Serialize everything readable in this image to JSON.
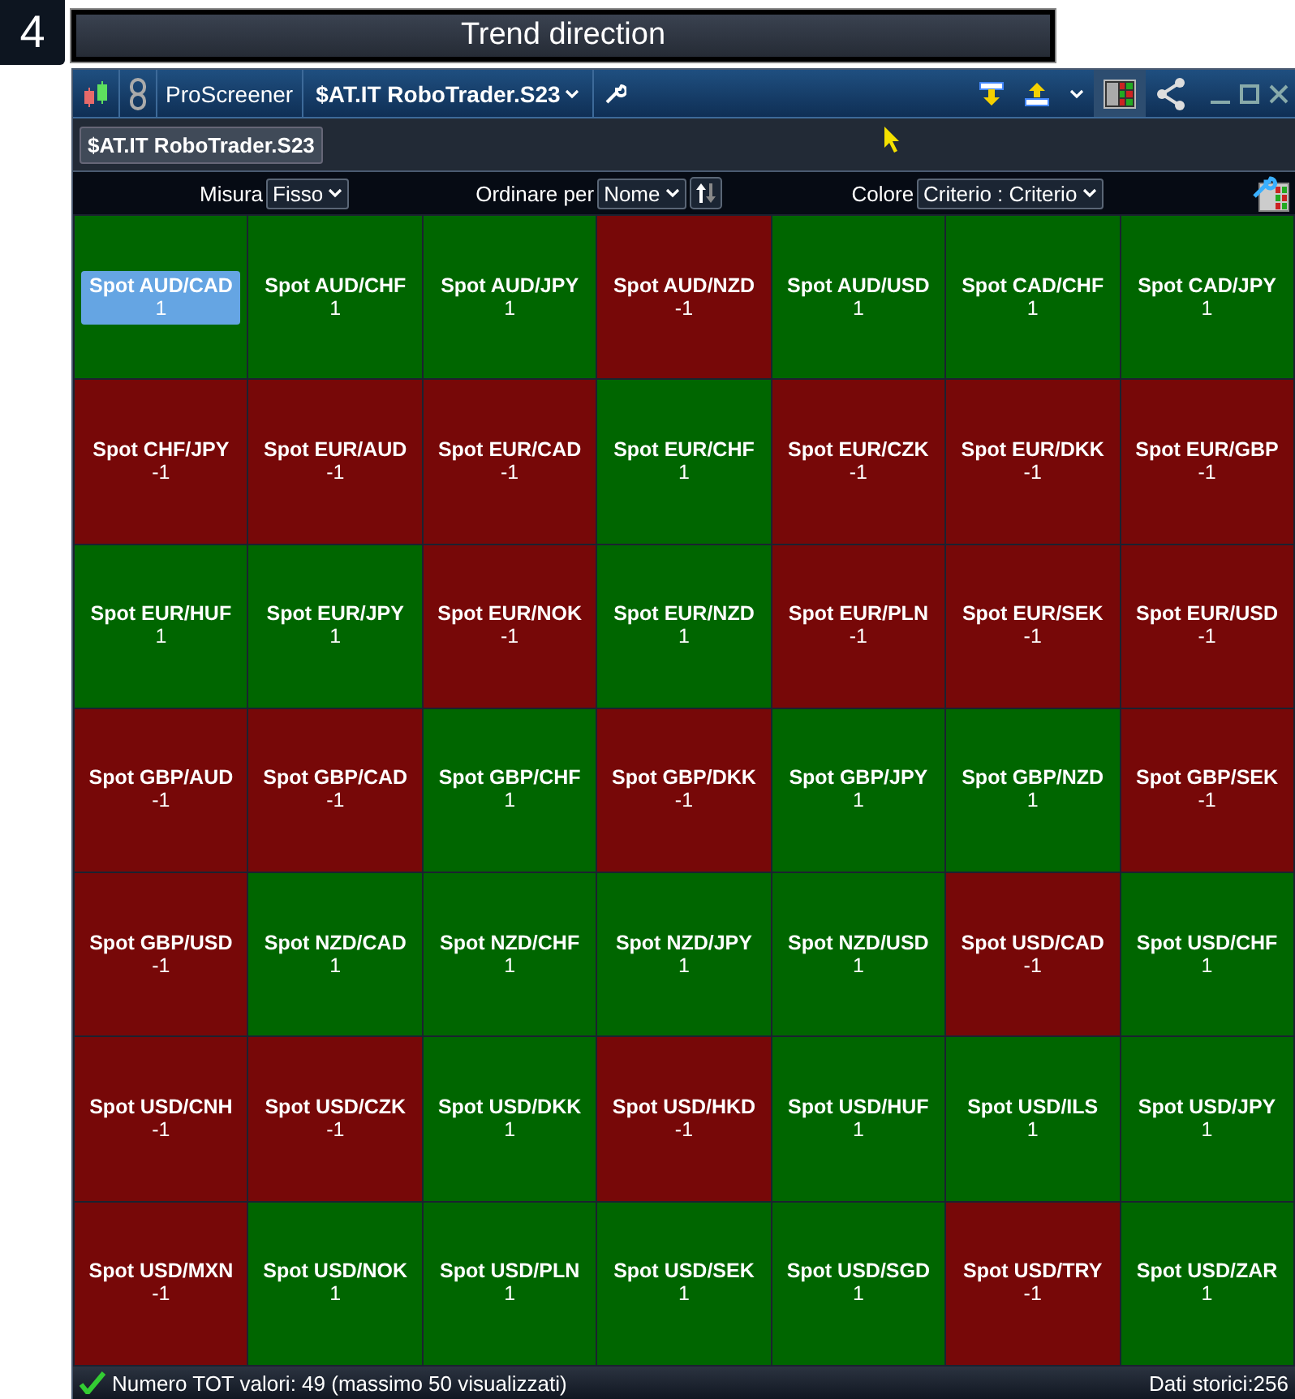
{
  "step": {
    "number": "4",
    "title": "Trend direction"
  },
  "window": {
    "app": "ProScreener",
    "screener": "$AT.IT RoboTrader.S23",
    "tab": "$AT.IT RoboTrader.S23"
  },
  "filters": {
    "size_label": "Misura",
    "size_value": "Fisso",
    "sort_label": "Ordinare per",
    "sort_value": "Nome",
    "color_label": "Colore",
    "color_value": "Criterio : Criterio"
  },
  "tiles": [
    {
      "name": "Spot AUD/CAD",
      "value": "1",
      "color": "#006600",
      "selected": true
    },
    {
      "name": "Spot AUD/CHF",
      "value": "1",
      "color": "#006600",
      "selected": false
    },
    {
      "name": "Spot AUD/JPY",
      "value": "1",
      "color": "#006600",
      "selected": false
    },
    {
      "name": "Spot AUD/NZD",
      "value": "-1",
      "color": "#770808",
      "selected": false
    },
    {
      "name": "Spot AUD/USD",
      "value": "1",
      "color": "#006600",
      "selected": false
    },
    {
      "name": "Spot CAD/CHF",
      "value": "1",
      "color": "#006600",
      "selected": false
    },
    {
      "name": "Spot CAD/JPY",
      "value": "1",
      "color": "#006600",
      "selected": false
    },
    {
      "name": "Spot CHF/JPY",
      "value": "-1",
      "color": "#770808",
      "selected": false
    },
    {
      "name": "Spot EUR/AUD",
      "value": "-1",
      "color": "#770808",
      "selected": false
    },
    {
      "name": "Spot EUR/CAD",
      "value": "-1",
      "color": "#770808",
      "selected": false
    },
    {
      "name": "Spot EUR/CHF",
      "value": "1",
      "color": "#006600",
      "selected": false
    },
    {
      "name": "Spot EUR/CZK",
      "value": "-1",
      "color": "#770808",
      "selected": false
    },
    {
      "name": "Spot EUR/DKK",
      "value": "-1",
      "color": "#770808",
      "selected": false
    },
    {
      "name": "Spot EUR/GBP",
      "value": "-1",
      "color": "#770808",
      "selected": false
    },
    {
      "name": "Spot EUR/HUF",
      "value": "1",
      "color": "#006600",
      "selected": false
    },
    {
      "name": "Spot EUR/JPY",
      "value": "1",
      "color": "#006600",
      "selected": false
    },
    {
      "name": "Spot EUR/NOK",
      "value": "-1",
      "color": "#770808",
      "selected": false
    },
    {
      "name": "Spot EUR/NZD",
      "value": "1",
      "color": "#006600",
      "selected": false
    },
    {
      "name": "Spot EUR/PLN",
      "value": "-1",
      "color": "#770808",
      "selected": false
    },
    {
      "name": "Spot EUR/SEK",
      "value": "-1",
      "color": "#770808",
      "selected": false
    },
    {
      "name": "Spot EUR/USD",
      "value": "-1",
      "color": "#770808",
      "selected": false
    },
    {
      "name": "Spot GBP/AUD",
      "value": "-1",
      "color": "#770808",
      "selected": false
    },
    {
      "name": "Spot GBP/CAD",
      "value": "-1",
      "color": "#770808",
      "selected": false
    },
    {
      "name": "Spot GBP/CHF",
      "value": "1",
      "color": "#006600",
      "selected": false
    },
    {
      "name": "Spot GBP/DKK",
      "value": "-1",
      "color": "#770808",
      "selected": false
    },
    {
      "name": "Spot GBP/JPY",
      "value": "1",
      "color": "#006600",
      "selected": false
    },
    {
      "name": "Spot GBP/NZD",
      "value": "1",
      "color": "#006600",
      "selected": false
    },
    {
      "name": "Spot GBP/SEK",
      "value": "-1",
      "color": "#770808",
      "selected": false
    },
    {
      "name": "Spot GBP/USD",
      "value": "-1",
      "color": "#770808",
      "selected": false
    },
    {
      "name": "Spot NZD/CAD",
      "value": "1",
      "color": "#006600",
      "selected": false
    },
    {
      "name": "Spot NZD/CHF",
      "value": "1",
      "color": "#006600",
      "selected": false
    },
    {
      "name": "Spot NZD/JPY",
      "value": "1",
      "color": "#006600",
      "selected": false
    },
    {
      "name": "Spot NZD/USD",
      "value": "1",
      "color": "#006600",
      "selected": false
    },
    {
      "name": "Spot USD/CAD",
      "value": "-1",
      "color": "#770808",
      "selected": false
    },
    {
      "name": "Spot USD/CHF",
      "value": "1",
      "color": "#006600",
      "selected": false
    },
    {
      "name": "Spot USD/CNH",
      "value": "-1",
      "color": "#770808",
      "selected": false
    },
    {
      "name": "Spot USD/CZK",
      "value": "-1",
      "color": "#770808",
      "selected": false
    },
    {
      "name": "Spot USD/DKK",
      "value": "1",
      "color": "#006600",
      "selected": false
    },
    {
      "name": "Spot USD/HKD",
      "value": "-1",
      "color": "#770808",
      "selected": false
    },
    {
      "name": "Spot USD/HUF",
      "value": "1",
      "color": "#006600",
      "selected": false
    },
    {
      "name": "Spot USD/ILS",
      "value": "1",
      "color": "#006600",
      "selected": false
    },
    {
      "name": "Spot USD/JPY",
      "value": "1",
      "color": "#006600",
      "selected": false
    },
    {
      "name": "Spot USD/MXN",
      "value": "-1",
      "color": "#770808",
      "selected": false
    },
    {
      "name": "Spot USD/NOK",
      "value": "1",
      "color": "#006600",
      "selected": false
    },
    {
      "name": "Spot USD/PLN",
      "value": "1",
      "color": "#006600",
      "selected": false
    },
    {
      "name": "Spot USD/SEK",
      "value": "1",
      "color": "#006600",
      "selected": false
    },
    {
      "name": "Spot USD/SGD",
      "value": "1",
      "color": "#006600",
      "selected": false
    },
    {
      "name": "Spot USD/TRY",
      "value": "-1",
      "color": "#770808",
      "selected": false
    },
    {
      "name": "Spot USD/ZAR",
      "value": "1",
      "color": "#006600",
      "selected": false
    }
  ],
  "status_bar": {
    "count": "Numero TOT valori: 49 (massimo 50 visualizzati)",
    "history": "Dati storici:256"
  }
}
